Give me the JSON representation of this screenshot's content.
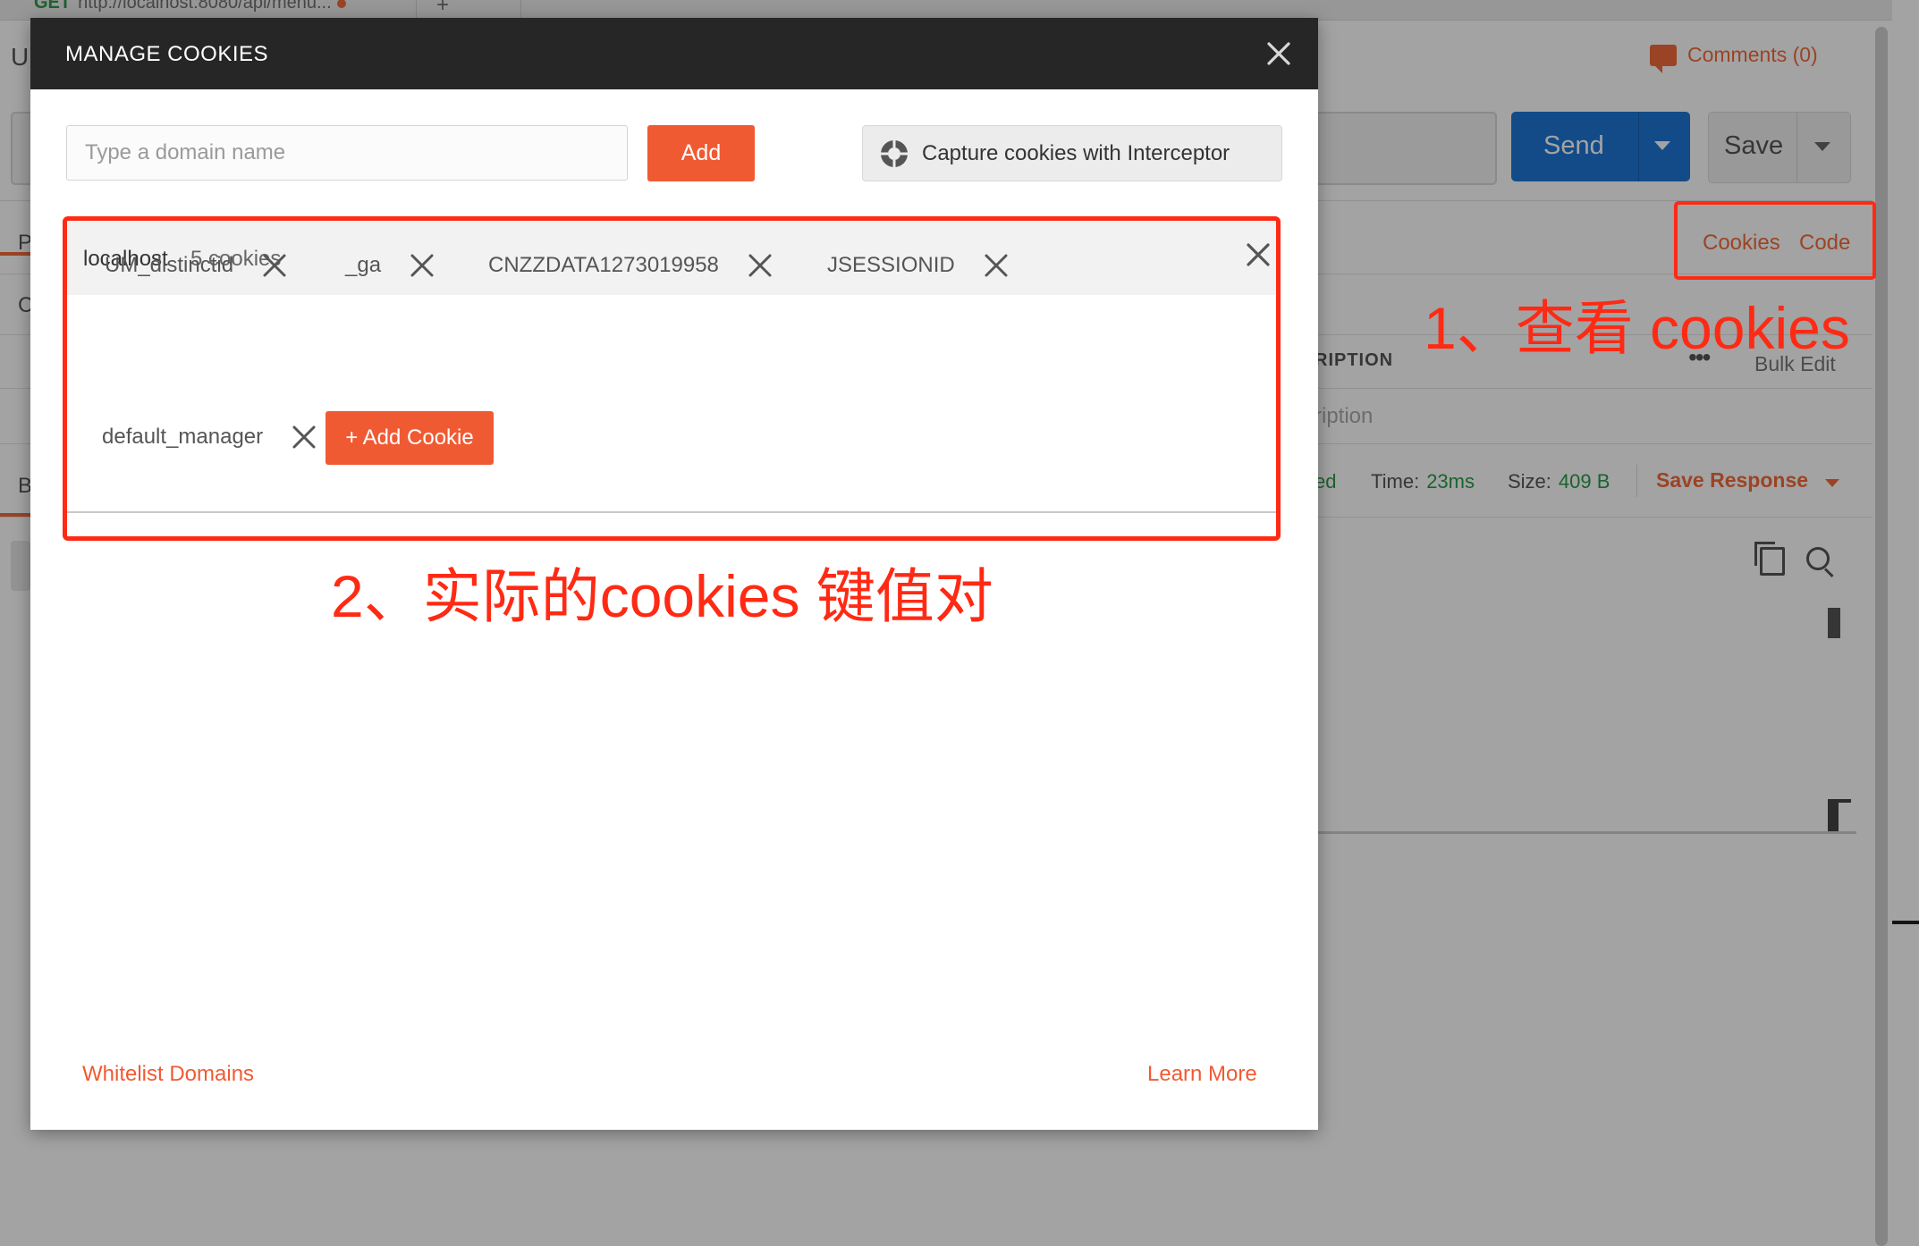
{
  "background": {
    "top_tab": {
      "method": "GET",
      "url": "http://localhost:8080/api/menu..."
    },
    "header_initial": "U",
    "comments_label": "Comments (0)",
    "send_label": "Send",
    "save_label": "Save",
    "cookies_link": "Cookies",
    "code_link": "Code",
    "left_tabs": [
      "P",
      "C",
      "Bo"
    ],
    "description_header": "RIPTION",
    "bulk_edit": "Bulk Edit",
    "description_placeholder": "ription",
    "status_fragment": "ed",
    "time_label": "Time:",
    "time_value": "23ms",
    "size_label": "Size:",
    "size_value": "409 B",
    "save_response": "Save Response"
  },
  "modal": {
    "title": "MANAGE COOKIES",
    "domain_input_placeholder": "Type a domain name",
    "add_label": "Add",
    "capture_label": "Capture cookies with Interceptor",
    "domain": {
      "name": "localhost",
      "count_label": "5 cookies",
      "cookies": [
        "UM_distinctid",
        "_ga",
        "CNZZDATA1273019958",
        "JSESSIONID",
        "default_manager"
      ]
    },
    "add_cookie_label": "+ Add Cookie",
    "whitelist_label": "Whitelist Domains",
    "learn_more_label": "Learn More"
  },
  "annotations": {
    "note1": "1、查看 cookies",
    "note2": "2、实际的cookies 键值对",
    "color": "#ff2a14"
  },
  "colors": {
    "accent": "#f05a33",
    "header_dark": "#262626",
    "send_blue": "#1e76d6"
  }
}
